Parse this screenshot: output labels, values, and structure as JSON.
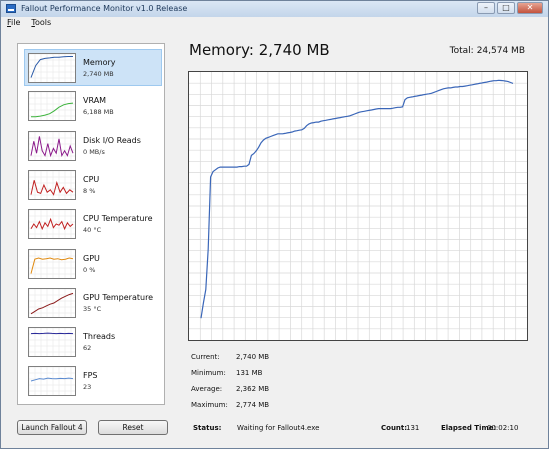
{
  "window": {
    "title": "Fallout Performance Monitor v1.0 Release"
  },
  "menu": [
    {
      "accel": "F",
      "rest": "ile"
    },
    {
      "accel": "T",
      "rest": "ools"
    }
  ],
  "sidebar": {
    "items": [
      {
        "label": "Memory",
        "value": "2,740 MB",
        "color": "#2a5aa8",
        "selected": true
      },
      {
        "label": "VRAM",
        "value": "6,188 MB",
        "color": "#3cb33c"
      },
      {
        "label": "Disk I/O Reads",
        "value": "0 MB/s",
        "color": "#8b1a8b"
      },
      {
        "label": "CPU",
        "value": "8 %",
        "color": "#c02020"
      },
      {
        "label": "CPU Temperature",
        "value": "40 °C",
        "color": "#c02020"
      },
      {
        "label": "GPU",
        "value": "0 %",
        "color": "#e08a10"
      },
      {
        "label": "GPU Temperature",
        "value": "35 °C",
        "color": "#8b1a1a"
      },
      {
        "label": "Threads",
        "value": "62",
        "color": "#2a2a9a"
      },
      {
        "label": "FPS",
        "value": "23",
        "color": "#5a8ad0"
      }
    ]
  },
  "main": {
    "title": "Memory: 2,740 MB",
    "total_label": "Total:",
    "total_value": "24,574 MB"
  },
  "chart_data": {
    "type": "line",
    "metric": "Memory",
    "unit": "MB",
    "grid": true,
    "ylim": [
      0,
      2800
    ],
    "x": [
      0,
      1,
      2,
      3,
      4,
      5,
      6,
      7,
      8,
      9,
      10,
      11,
      12,
      13,
      14,
      15,
      16,
      17,
      18,
      19,
      20,
      21,
      22,
      23,
      24,
      25,
      26,
      27,
      28,
      29,
      30,
      31,
      32,
      33,
      34,
      35,
      36,
      37,
      38,
      39,
      40,
      41,
      42,
      43,
      44,
      45,
      46,
      47,
      48,
      49,
      50,
      51,
      52,
      53,
      54,
      55,
      56,
      57,
      58,
      59,
      60,
      61,
      62,
      63,
      64,
      65,
      66,
      67,
      68,
      69,
      70,
      71,
      72,
      73,
      74,
      75,
      76,
      77,
      78,
      79,
      80,
      81,
      82,
      83,
      84,
      85,
      86,
      87,
      88,
      89,
      90,
      91,
      92,
      93,
      94,
      95,
      96,
      97,
      98,
      99,
      100,
      101,
      102,
      103,
      104,
      105,
      106,
      107,
      108,
      109,
      110,
      111,
      112,
      113,
      114,
      115,
      116,
      117,
      118,
      119,
      120,
      121,
      122,
      123,
      124,
      125,
      126,
      127,
      128,
      129,
      130
    ],
    "series": [
      {
        "color": "#3a66b8",
        "values": [
          131,
          300,
          450,
          900,
          1700,
          1760,
          1780,
          1800,
          1810,
          1810,
          1810,
          1810,
          1810,
          1810,
          1810,
          1810,
          1815,
          1815,
          1820,
          1820,
          1840,
          1940,
          1960,
          1990,
          2030,
          2080,
          2110,
          2130,
          2140,
          2150,
          2160,
          2170,
          2180,
          2180,
          2180,
          2185,
          2190,
          2195,
          2200,
          2210,
          2215,
          2220,
          2225,
          2240,
          2270,
          2290,
          2300,
          2305,
          2310,
          2310,
          2320,
          2325,
          2330,
          2335,
          2340,
          2345,
          2350,
          2355,
          2360,
          2365,
          2370,
          2375,
          2380,
          2390,
          2400,
          2410,
          2420,
          2425,
          2430,
          2435,
          2440,
          2445,
          2450,
          2455,
          2460,
          2460,
          2460,
          2460,
          2460,
          2460,
          2465,
          2470,
          2475,
          2475,
          2480,
          2560,
          2580,
          2585,
          2590,
          2595,
          2600,
          2605,
          2610,
          2615,
          2620,
          2625,
          2630,
          2640,
          2650,
          2660,
          2670,
          2680,
          2685,
          2690,
          2690,
          2695,
          2700,
          2700,
          2705,
          2705,
          2710,
          2715,
          2720,
          2725,
          2730,
          2735,
          2740,
          2745,
          2750,
          2755,
          2760,
          2765,
          2770,
          2770,
          2774,
          2772,
          2770,
          2765,
          2760,
          2750,
          2740
        ]
      }
    ]
  },
  "stats": [
    {
      "label": "Current:",
      "value": "2,740 MB"
    },
    {
      "label": "Minimum:",
      "value": "131 MB"
    },
    {
      "label": "Average:",
      "value": "2,362 MB"
    },
    {
      "label": "Maximum:",
      "value": "2,774 MB"
    }
  ],
  "buttons": {
    "launch": "Launch Fallout 4",
    "reset": "Reset"
  },
  "footer": {
    "status_label": "Status:",
    "status_value": "Waiting for Fallout4.exe",
    "count_label": "Count:",
    "count_value": "131",
    "elapsed_label": "Elapsed Time:",
    "elapsed_value": "00:02:10"
  }
}
